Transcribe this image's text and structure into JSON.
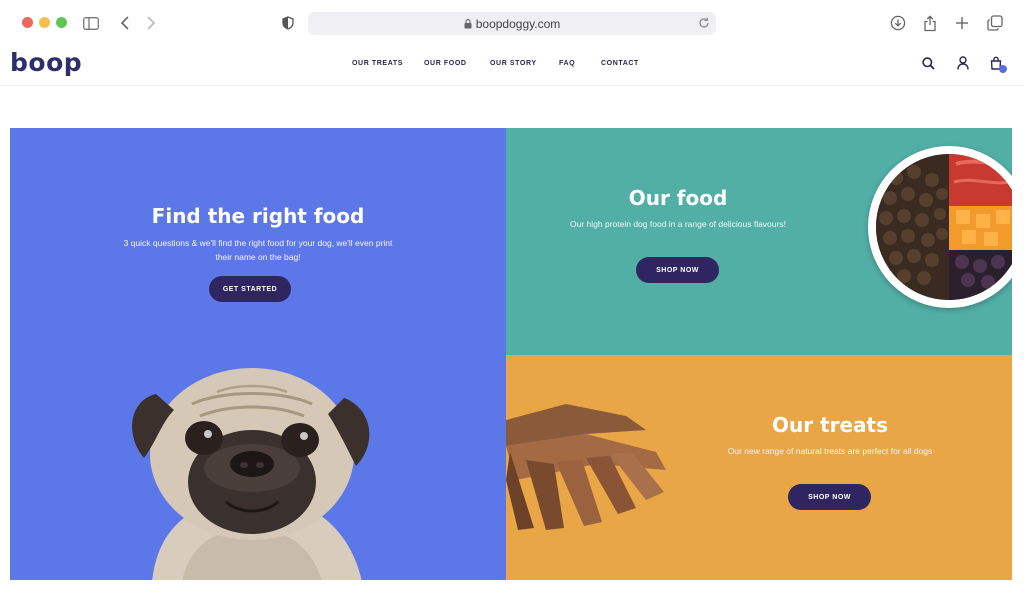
{
  "browser": {
    "url": "boopdoggy.com"
  },
  "header": {
    "logo": "boop",
    "nav": [
      {
        "label": "OUR TREATS"
      },
      {
        "label": "OUR FOOD"
      },
      {
        "label": "OUR STORY"
      },
      {
        "label": "FAQ"
      },
      {
        "label": "CONTACT"
      }
    ],
    "icons": [
      "search-icon",
      "account-icon",
      "cart-icon"
    ]
  },
  "hero": {
    "title": "Find the right food",
    "text": "3 quick questions & we'll find the right food for your dog, we'll even print their name on the bag!",
    "button": "GET STARTED",
    "color": "#5c77e8"
  },
  "food": {
    "title": "Our food",
    "text": "Our high protein dog food in a range of delicious flavours!",
    "button": "SHOP NOW",
    "color": "#52afa6"
  },
  "treats": {
    "title": "Our treats",
    "text": "Our new range of natural treats are perfect for all dogs",
    "button": "SHOP NOW",
    "color": "#e8a646"
  },
  "colors": {
    "brand_dark": "#2f2561",
    "logo": "#2d2f6b"
  }
}
